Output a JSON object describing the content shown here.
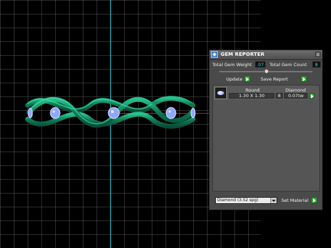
{
  "panel": {
    "title": "GEM REPORTER",
    "close_glyph": "x",
    "total_weight_label": "Total Gem Weight",
    "total_weight_value": ".07",
    "total_count_label": "Total Gem Count",
    "total_count_value": "8",
    "update_label": "Update",
    "save_report_label": "Save Report",
    "table": {
      "header_shape": "Round",
      "header_material": "Diamond",
      "rows": [
        {
          "size": "1.30 X 1.30",
          "count": "8",
          "weight": "0.07tw"
        }
      ]
    },
    "material_select_value": "Diamond   (3.52 spg)",
    "set_material_label": "Set Material"
  },
  "colors": {
    "ring": "#1b9a72",
    "gem": "#8fa8ff",
    "axis_vertical": "#2fd6e0",
    "axis_horizontal": "#b22222",
    "go_button": "#3aa83a",
    "value_text": "#3de0e8"
  }
}
